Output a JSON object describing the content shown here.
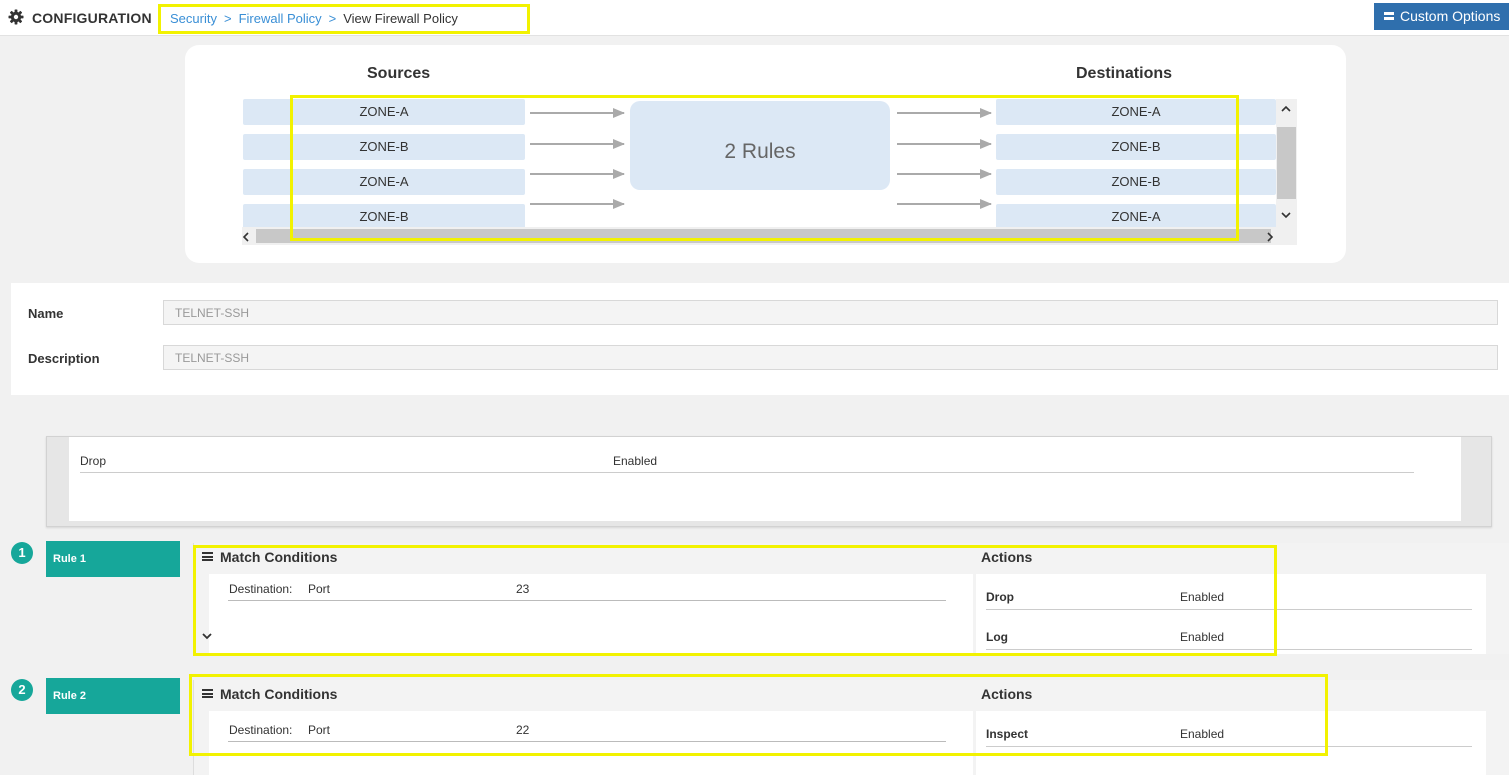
{
  "header": {
    "section_title": "CONFIGURATION",
    "breadcrumb": [
      {
        "label": "Security",
        "link": true
      },
      {
        "label": "Firewall Policy",
        "link": true
      },
      {
        "label": "View Firewall Policy",
        "link": false
      }
    ],
    "separator": ">",
    "custom_options_label": "Custom Options"
  },
  "flow": {
    "sources_label": "Sources",
    "destinations_label": "Destinations",
    "sources": [
      "ZONE-A",
      "ZONE-B",
      "ZONE-A",
      "ZONE-B"
    ],
    "destinations": [
      "ZONE-A",
      "ZONE-B",
      "ZONE-B",
      "ZONE-A"
    ],
    "rules_summary": "2 Rules"
  },
  "policy": {
    "name_label": "Name",
    "name_value": "TELNET-SSH",
    "description_label": "Description",
    "description_value": "TELNET-SSH"
  },
  "default_action": {
    "action": "Drop",
    "status": "Enabled"
  },
  "rules": [
    {
      "number": "1",
      "label": "Rule 1",
      "match_title": "Match Conditions",
      "condition_label": "Destination:",
      "condition_field": "Port",
      "condition_value": "23",
      "actions_title": "Actions",
      "actions": [
        {
          "name": "Drop",
          "status": "Enabled"
        },
        {
          "name": "Log",
          "status": "Enabled"
        }
      ]
    },
    {
      "number": "2",
      "label": "Rule 2",
      "match_title": "Match Conditions",
      "condition_label": "Destination:",
      "condition_field": "Port",
      "condition_value": "22",
      "actions_title": "Actions",
      "actions": [
        {
          "name": "Inspect",
          "status": "Enabled"
        }
      ]
    }
  ],
  "colors": {
    "accent_teal": "#16a79a",
    "link_blue": "#3a8fd6",
    "button_blue": "#2f6fad",
    "zone_fill": "#dce8f5",
    "highlight_yellow": "#f2f200"
  }
}
